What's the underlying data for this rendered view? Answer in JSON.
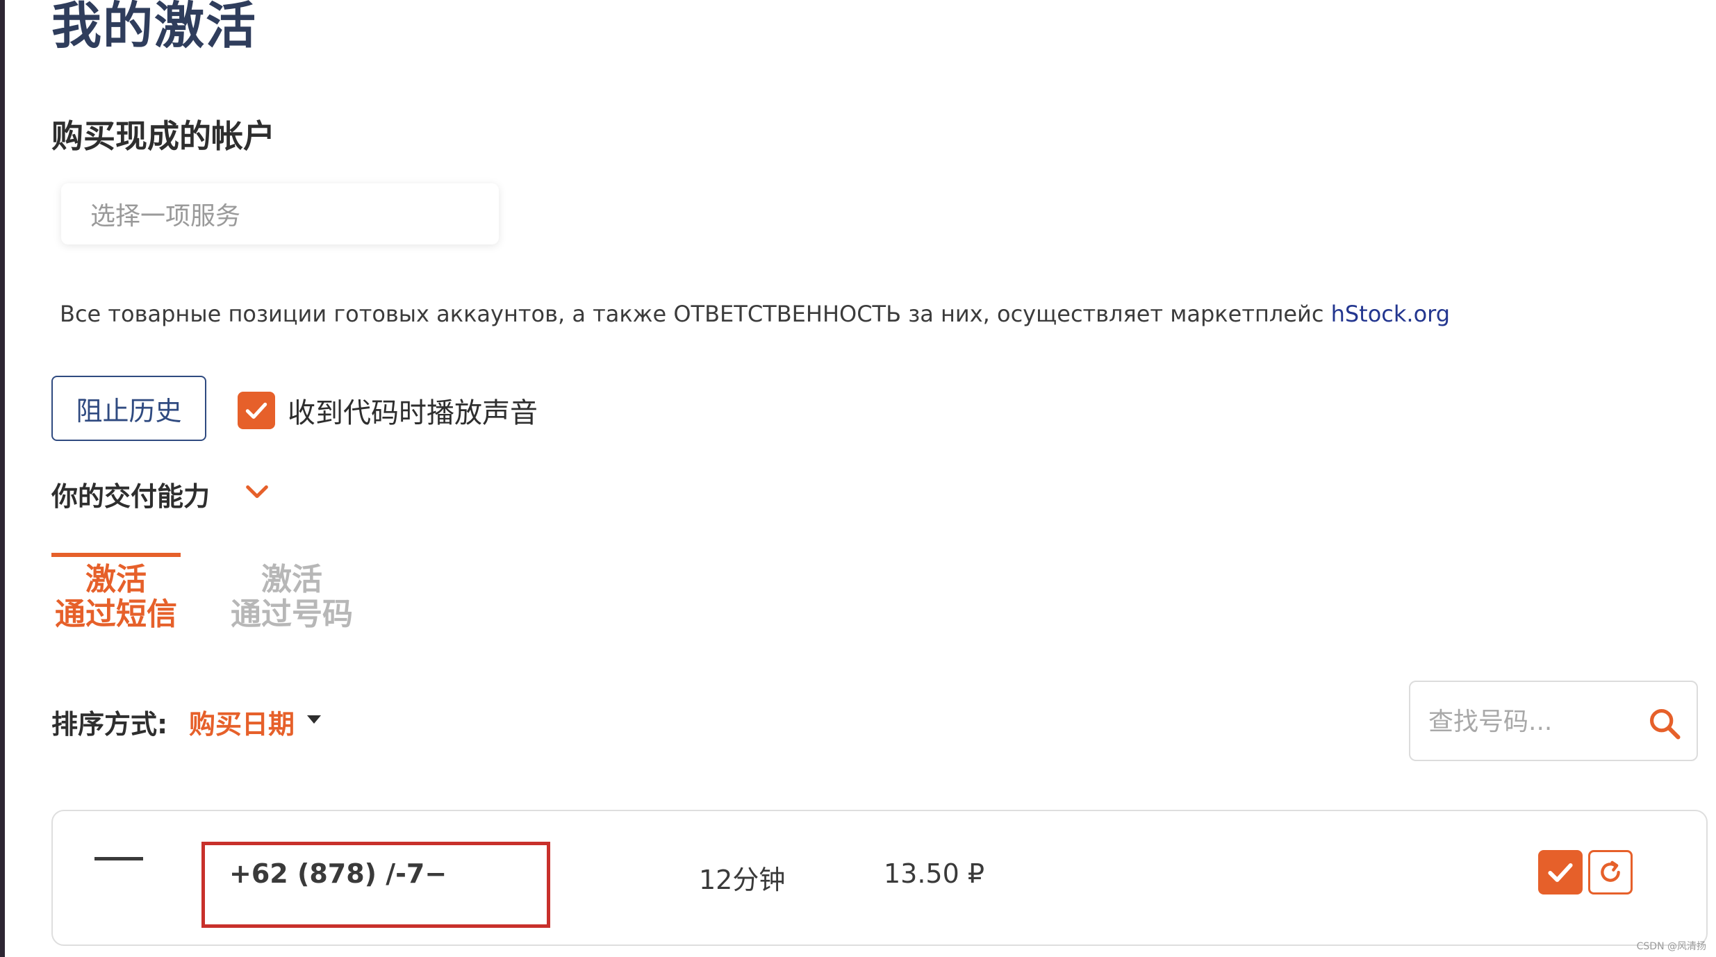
{
  "page": {
    "title": "我的激活",
    "section_title": "购买现成的帐户"
  },
  "service_select": {
    "placeholder": "选择一项服务"
  },
  "notice": {
    "text": "Все товарные позиции готовых аккаунтов, а также ОТВЕТСТВЕННОСТЬ за них, осуществляет маркетплейс ",
    "link_text": "hStock.org"
  },
  "controls": {
    "block_history_label": "阻止历史",
    "sound_label": "收到代码时播放声音",
    "sound_checked": true,
    "delivery_label": "你的交付能力"
  },
  "tabs": [
    {
      "line1": "激活",
      "line2": "通过短信",
      "active": true
    },
    {
      "line1": "激活",
      "line2": "通过号码",
      "active": false
    }
  ],
  "sort": {
    "label": "排序方式:",
    "value": "购买日期"
  },
  "search": {
    "placeholder": "查找号码..."
  },
  "activation": {
    "phone": "+62 (878) /-7−",
    "duration": "12分钟",
    "price": "13.50 ₽"
  },
  "watermark": "CSDN @风清扬",
  "colors": {
    "accent": "#e6602a",
    "title": "#2f3d5c",
    "link": "#23368f",
    "highlight": "#c8302b"
  }
}
